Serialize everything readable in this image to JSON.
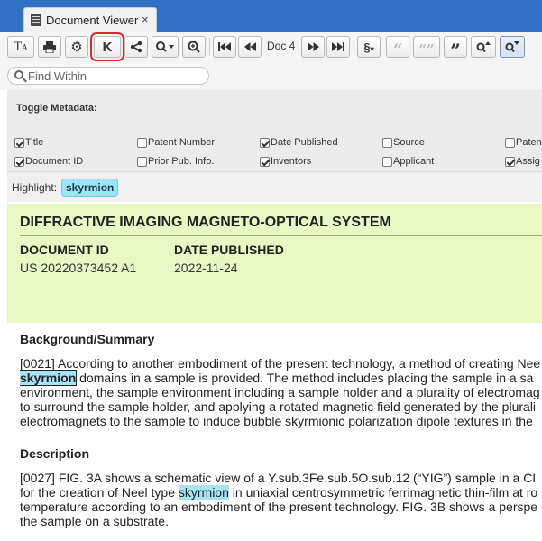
{
  "tab": {
    "title": "Document Viewer",
    "close": "×",
    "icon": "document-icon"
  },
  "toolbar": {
    "buttons": [
      {
        "name": "text-size-button",
        "icon": "text-size-icon",
        "glyph": "Tₐ"
      },
      {
        "name": "print-button",
        "icon": "printer-icon",
        "glyph": "⎙"
      },
      {
        "name": "settings-button",
        "icon": "gear-icon",
        "glyph": "⚙"
      },
      {
        "name": "kwic-button",
        "icon": "kwic-icon",
        "glyph": "K"
      },
      {
        "name": "share-button",
        "icon": "share-icon",
        "glyph": "<"
      },
      {
        "name": "search-menu-button",
        "icon": "search-dropdown-icon",
        "glyph": "🔍▾"
      },
      {
        "name": "zoom-button",
        "icon": "zoom-in-icon",
        "glyph": "⊕"
      },
      {
        "name": "first-doc-button",
        "icon": "skip-first-icon",
        "glyph": "⏮"
      },
      {
        "name": "prev-doc-button",
        "icon": "rewind-icon",
        "glyph": "⏪"
      },
      {
        "name": "next-doc-button",
        "icon": "fast-forward-icon",
        "glyph": "⏩"
      },
      {
        "name": "last-doc-button",
        "icon": "skip-last-icon",
        "glyph": "⏭"
      },
      {
        "name": "section-button",
        "icon": "section-dropdown-icon",
        "glyph": "§▾"
      },
      {
        "name": "quote-button-1",
        "icon": "quote-open-icon",
        "glyph": "“"
      },
      {
        "name": "quote-button-2",
        "icon": "quote-double-icon",
        "glyph": "“”"
      },
      {
        "name": "quote-button-3",
        "icon": "quote-close-icon",
        "glyph": "”"
      },
      {
        "name": "prev-hit-button",
        "icon": "search-up-icon",
        "glyph": "Q↑"
      },
      {
        "name": "next-hit-button",
        "icon": "search-down-icon",
        "glyph": "Q↓"
      }
    ],
    "doc_label": "Doc 4"
  },
  "search": {
    "placeholder": "Find Within"
  },
  "metadata": {
    "title": "Toggle Metadata:",
    "fields": [
      {
        "label": "Title",
        "checked": true
      },
      {
        "label": "Document ID",
        "checked": true
      },
      {
        "label": "Patent Number",
        "checked": false
      },
      {
        "label": "Prior Pub. Info.",
        "checked": false
      },
      {
        "label": "Date Published",
        "checked": true
      },
      {
        "label": "Inventors",
        "checked": true
      },
      {
        "label": "Source",
        "checked": false
      },
      {
        "label": "Applicant",
        "checked": false
      },
      {
        "label": "Paten",
        "checked": false
      },
      {
        "label": "Assig",
        "checked": true
      }
    ]
  },
  "highlight": {
    "label": "Highlight:",
    "term": "skyrmion"
  },
  "document": {
    "title": "DIFFRACTIVE IMAGING MAGNETO-OPTICAL SYSTEM",
    "doc_id_label": "DOCUMENT ID",
    "doc_id_value": "US 20220373452 A1",
    "date_label": "DATE PUBLISHED",
    "date_value": "2022-11-24"
  },
  "sections": [
    {
      "heading": "Background/Summary",
      "lines": [
        {
          "pre": "[0021] According to another embodiment of the present technology, a method of creating Nee",
          "hit": "",
          "post": ""
        },
        {
          "pre": "",
          "hit": "skyrmion",
          "post": " domains in a sample is provided. The method includes placing the sample in a sa"
        },
        {
          "pre": "environment, the sample environment including a sample holder and a plurality of electromag",
          "hit": "",
          "post": ""
        },
        {
          "pre": "to surround the sample holder, and applying a rotated magnetic field generated by the plurali",
          "hit": "",
          "post": ""
        },
        {
          "pre": "electromagnets to the sample to induce bubble skyrmionic polarization dipole textures in the",
          "hit": "",
          "post": ""
        }
      ]
    },
    {
      "heading": "Description",
      "lines": [
        {
          "pre": "[0027] FIG. 3A shows a schematic view of a Y.sub.3Fe.sub.5O.sub.12 (“YIG”) sample in a CI",
          "hit": "",
          "post": ""
        },
        {
          "pre": "for the creation of Neel type ",
          "hit": "skyrmion",
          "post": " in uniaxial centrosymmetric ferrimagnetic thin-film at ro"
        },
        {
          "pre": "temperature according to an embodiment of the present technology. FIG. 3B shows a perspe",
          "hit": "",
          "post": ""
        },
        {
          "pre": "the sample on a substrate.",
          "hit": "",
          "post": ""
        }
      ]
    }
  ]
}
